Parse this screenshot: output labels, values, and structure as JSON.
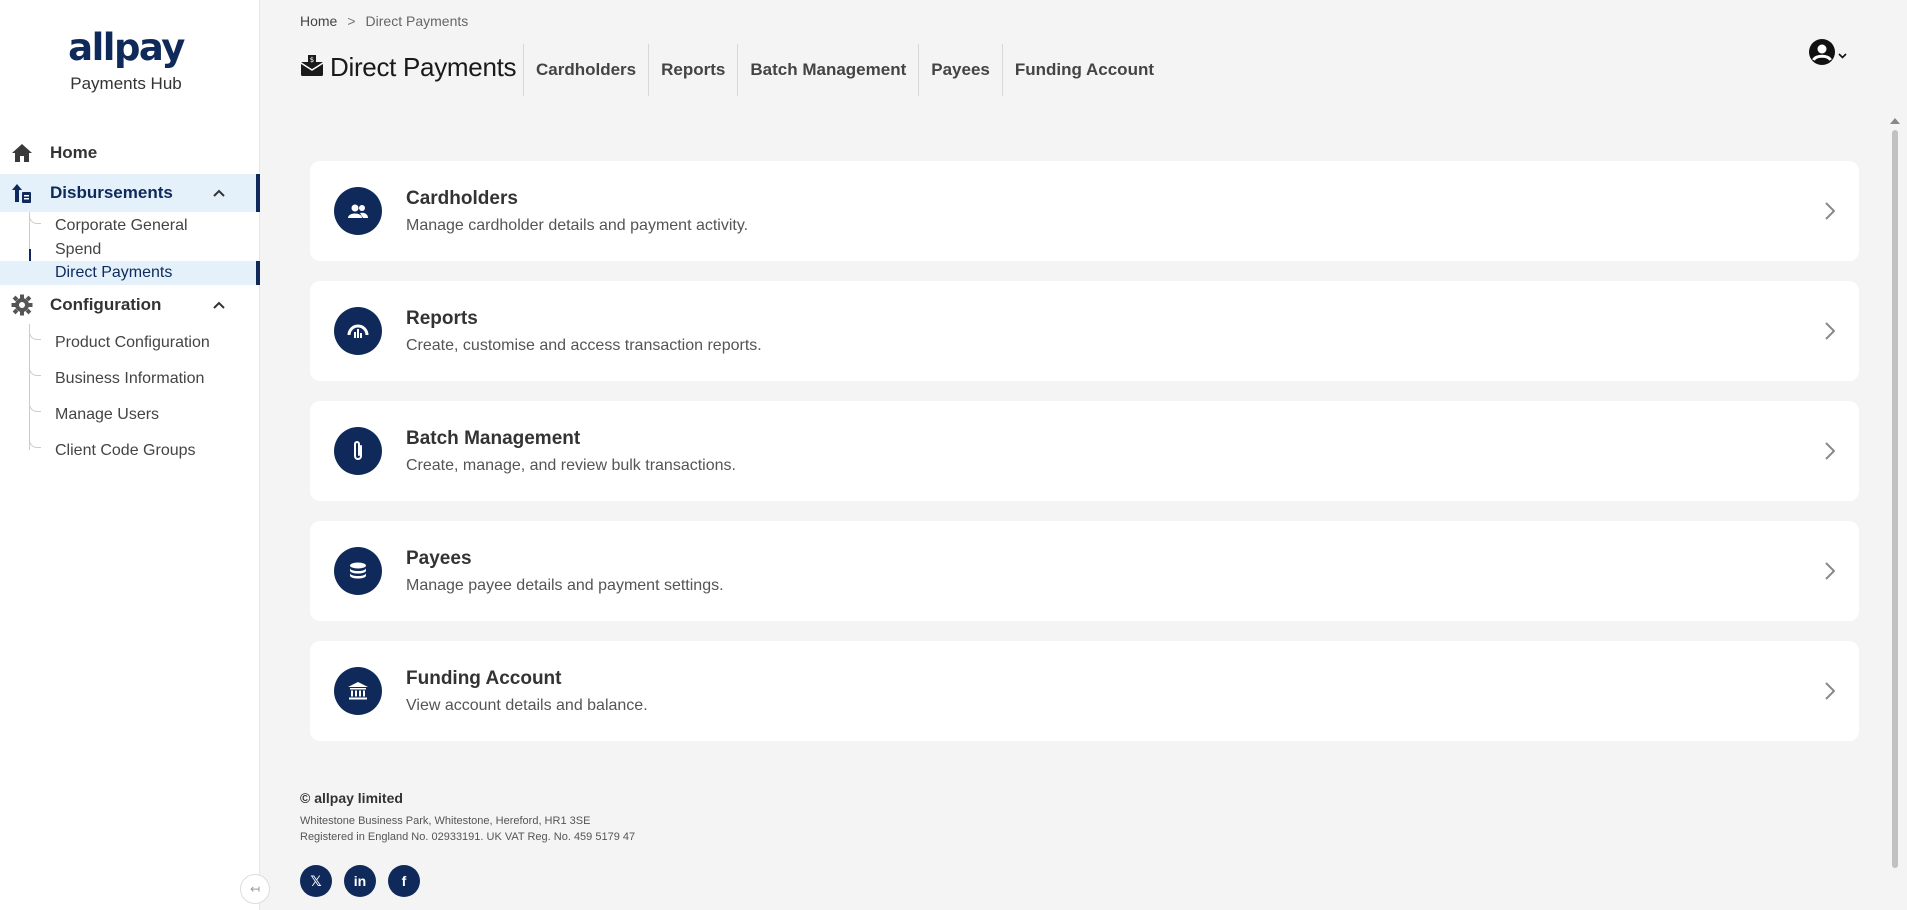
{
  "brand": {
    "logo": "allpay",
    "subtitle": "Payments Hub"
  },
  "sidebar": {
    "home": {
      "label": "Home",
      "icon": "home-icon"
    },
    "disbursements": {
      "label": "Disbursements",
      "icon": "upload-document-icon",
      "expanded": true,
      "children": [
        {
          "label": "Corporate General Spend"
        },
        {
          "label": "Direct Payments",
          "active": true
        }
      ]
    },
    "configuration": {
      "label": "Configuration",
      "icon": "gear-icon",
      "expanded": true,
      "children": [
        {
          "label": "Product Configuration"
        },
        {
          "label": "Business Information"
        },
        {
          "label": "Manage Users"
        },
        {
          "label": "Client Code Groups"
        }
      ]
    }
  },
  "breadcrumb": {
    "home": "Home",
    "separator": ">",
    "current": "Direct Payments"
  },
  "header": {
    "title": "Direct Payments",
    "tabs": [
      "Cardholders",
      "Reports",
      "Batch Management",
      "Payees",
      "Funding Account"
    ]
  },
  "cards": [
    {
      "title": "Cardholders",
      "description": "Manage cardholder details and payment activity.",
      "icon": "users-icon"
    },
    {
      "title": "Reports",
      "description": "Create, customise and access transaction reports.",
      "icon": "report-gauge-icon"
    },
    {
      "title": "Batch Management",
      "description": "Create, manage, and review bulk transactions.",
      "icon": "paperclip-icon"
    },
    {
      "title": "Payees",
      "description": "Manage payee details and payment settings.",
      "icon": "coins-icon"
    },
    {
      "title": "Funding Account",
      "description": "View account details and balance.",
      "icon": "bank-icon"
    }
  ],
  "footer": {
    "company": "© allpay limited",
    "address": "Whitestone Business Park, Whitestone, Hereford, HR1 3SE",
    "registration": "Registered in England No. 02933191. UK VAT Reg. No. 459 5179 47",
    "socials": [
      "x-icon",
      "linkedin-icon",
      "facebook-icon"
    ]
  },
  "colors": {
    "brand": "#0f2a5a",
    "active_bg": "#e4f1fb",
    "page_bg": "#f4f4f4"
  }
}
